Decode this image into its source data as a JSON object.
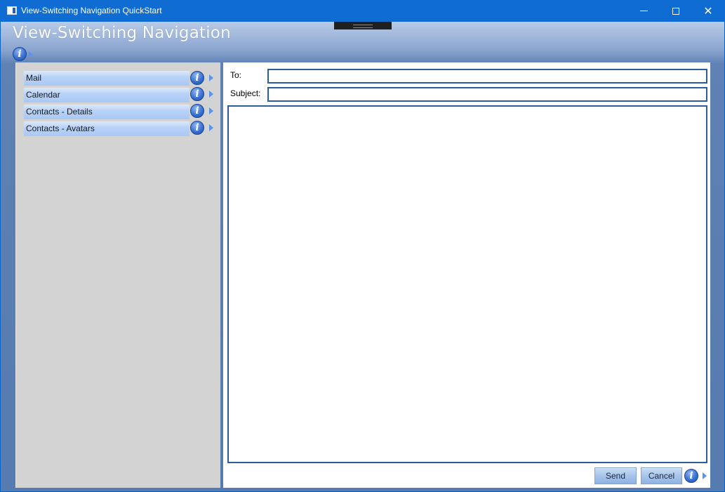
{
  "window": {
    "title": "View-Switching Navigation QuickStart",
    "minimize_glyph": "minimize-icon",
    "maximize_glyph": "maximize-icon",
    "close_glyph": "✕"
  },
  "header": {
    "title": "View-Switching Navigation",
    "info_glyph": "i"
  },
  "nav": {
    "items": [
      {
        "label": "Mail"
      },
      {
        "label": "Calendar"
      },
      {
        "label": "Contacts - Details"
      },
      {
        "label": "Contacts - Avatars"
      }
    ],
    "info_glyph": "i"
  },
  "compose": {
    "to_label": "To:",
    "to_value": "",
    "subject_label": "Subject:",
    "subject_value": "",
    "body_value": "",
    "send_label": "Send",
    "cancel_label": "Cancel",
    "info_glyph": "i"
  },
  "colors": {
    "titlebar": "#0f6cd3",
    "accent_border": "#2a5d99",
    "nav_panel": "#d3d3d3",
    "nav_item": "#b9d3f7"
  }
}
